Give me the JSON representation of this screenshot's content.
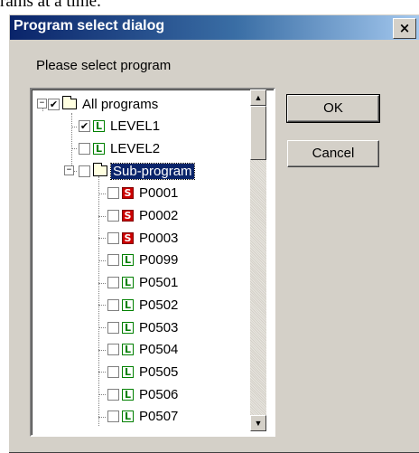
{
  "background_caption": "rams at a time.",
  "dialog": {
    "title": "Program select dialog",
    "close_glyph": "×",
    "prompt": "Please select program",
    "buttons": {
      "ok": "OK",
      "cancel": "Cancel"
    }
  },
  "tree": {
    "items": [
      {
        "label": "All programs",
        "icon": "folder-icon",
        "checked": true,
        "selected": false,
        "expander": "−"
      },
      {
        "label": "LEVEL1",
        "icon": "ladder-icon",
        "checked": true,
        "selected": false
      },
      {
        "label": "LEVEL2",
        "icon": "ladder-icon",
        "checked": false,
        "selected": false
      },
      {
        "label": "Sub-program",
        "icon": "folder-icon",
        "checked": false,
        "selected": true,
        "expander": "−"
      },
      {
        "label": "P0001",
        "icon": "sfc-icon",
        "checked": false,
        "selected": false
      },
      {
        "label": "P0002",
        "icon": "sfc-icon",
        "checked": false,
        "selected": false
      },
      {
        "label": "P0003",
        "icon": "sfc-icon",
        "checked": false,
        "selected": false
      },
      {
        "label": "P0099",
        "icon": "ladder-icon",
        "checked": false,
        "selected": false
      },
      {
        "label": "P0501",
        "icon": "ladder-icon",
        "checked": false,
        "selected": false
      },
      {
        "label": "P0502",
        "icon": "ladder-icon",
        "checked": false,
        "selected": false
      },
      {
        "label": "P0503",
        "icon": "ladder-icon",
        "checked": false,
        "selected": false
      },
      {
        "label": "P0504",
        "icon": "ladder-icon",
        "checked": false,
        "selected": false
      },
      {
        "label": "P0505",
        "icon": "ladder-icon",
        "checked": false,
        "selected": false
      },
      {
        "label": "P0506",
        "icon": "ladder-icon",
        "checked": false,
        "selected": false
      },
      {
        "label": "P0507",
        "icon": "ladder-icon",
        "checked": false,
        "selected": false
      }
    ],
    "icon_letters": {
      "ladder": "L",
      "sfc": "S"
    },
    "check_glyph": "✔",
    "scroll": {
      "up_glyph": "▲",
      "down_glyph": "▼"
    }
  },
  "colors": {
    "title_start": "#0a246a",
    "title_end": "#a6caf0",
    "selection": "#0a246a",
    "ladder_tag": "#008000",
    "sfc_tag": "#cc0000"
  }
}
